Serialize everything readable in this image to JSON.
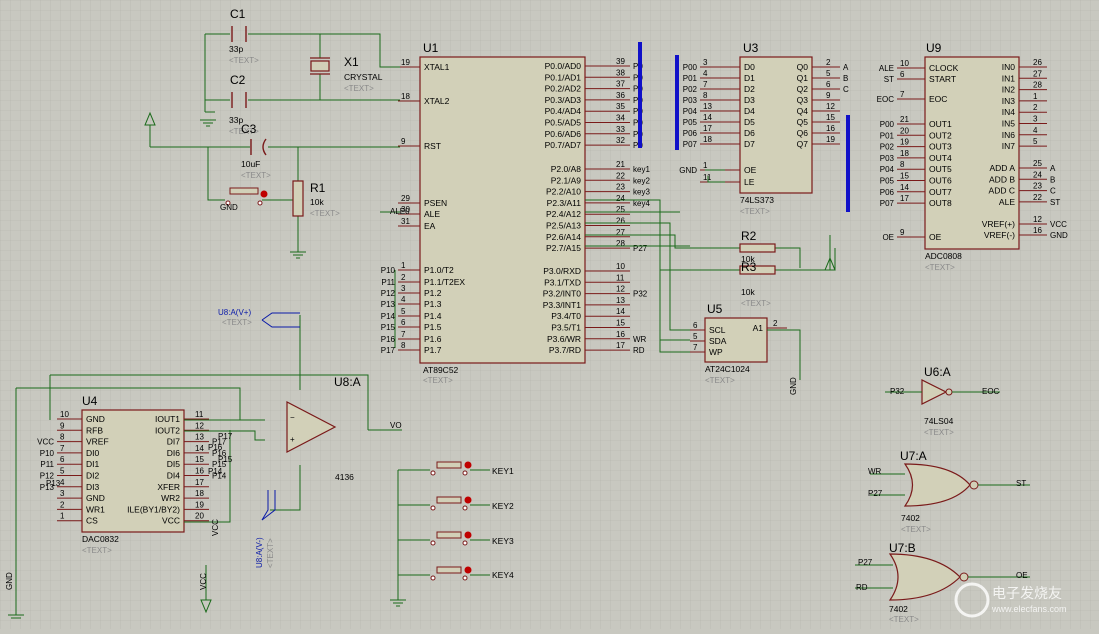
{
  "common": {
    "text_tag": "<TEXT>"
  },
  "u1": {
    "ref": "U1",
    "part": "AT89C52",
    "left": [
      {
        "num": "19",
        "name": "XTAL1"
      },
      {
        "num": "18",
        "name": "XTAL2"
      },
      {
        "num": "9",
        "name": "RST"
      },
      {
        "num": "29",
        "name": "PSEN"
      },
      {
        "num": "30",
        "name": "ALE"
      },
      {
        "num": "31",
        "name": "EA"
      },
      {
        "num": "1",
        "name": "P1.0/T2",
        "net": "P10"
      },
      {
        "num": "2",
        "name": "P1.1/T2EX",
        "net": "P11"
      },
      {
        "num": "3",
        "name": "P1.2",
        "net": "P12"
      },
      {
        "num": "4",
        "name": "P1.3",
        "net": "P13"
      },
      {
        "num": "5",
        "name": "P1.4",
        "net": "P14"
      },
      {
        "num": "6",
        "name": "P1.5",
        "net": "P15"
      },
      {
        "num": "7",
        "name": "P1.6",
        "net": "P16"
      },
      {
        "num": "8",
        "name": "P1.7",
        "net": "P17"
      }
    ],
    "right": [
      {
        "num": "39",
        "name": "P0.0/AD0",
        "net": "P0"
      },
      {
        "num": "38",
        "name": "P0.1/AD1",
        "net": "P0"
      },
      {
        "num": "37",
        "name": "P0.2/AD2",
        "net": "P0"
      },
      {
        "num": "36",
        "name": "P0.3/AD3",
        "net": "P0"
      },
      {
        "num": "35",
        "name": "P0.4/AD4",
        "net": "P0"
      },
      {
        "num": "34",
        "name": "P0.5/AD5",
        "net": "P0"
      },
      {
        "num": "33",
        "name": "P0.6/AD6",
        "net": "P0"
      },
      {
        "num": "32",
        "name": "P0.7/AD7",
        "net": "P0"
      },
      {
        "num": "21",
        "name": "P2.0/A8",
        "net": "key1"
      },
      {
        "num": "22",
        "name": "P2.1/A9",
        "net": "key2"
      },
      {
        "num": "23",
        "name": "P2.2/A10",
        "net": "key3"
      },
      {
        "num": "24",
        "name": "P2.3/A11",
        "net": "key4"
      },
      {
        "num": "25",
        "name": "P2.4/A12"
      },
      {
        "num": "26",
        "name": "P2.5/A13"
      },
      {
        "num": "27",
        "name": "P2.6/A14"
      },
      {
        "num": "28",
        "name": "P2.7/A15",
        "net": "P27"
      },
      {
        "num": "10",
        "name": "P3.0/RXD"
      },
      {
        "num": "11",
        "name": "P3.1/TXD"
      },
      {
        "num": "12",
        "name": "P3.2/INT0",
        "net": "P32"
      },
      {
        "num": "13",
        "name": "P3.3/INT1"
      },
      {
        "num": "14",
        "name": "P3.4/T0"
      },
      {
        "num": "15",
        "name": "P3.5/T1"
      },
      {
        "num": "16",
        "name": "P3.6/WR",
        "net": "WR"
      },
      {
        "num": "17",
        "name": "P3.7/RD",
        "net": "RD"
      }
    ]
  },
  "u3": {
    "ref": "U3",
    "part": "74LS373",
    "left": [
      {
        "num": "3",
        "name": "D0",
        "net": "P00"
      },
      {
        "num": "4",
        "name": "D1",
        "net": "P01"
      },
      {
        "num": "7",
        "name": "D2",
        "net": "P02"
      },
      {
        "num": "8",
        "name": "D3",
        "net": "P03"
      },
      {
        "num": "13",
        "name": "D4",
        "net": "P04"
      },
      {
        "num": "14",
        "name": "D5",
        "net": "P05"
      },
      {
        "num": "17",
        "name": "D6",
        "net": "P06"
      },
      {
        "num": "18",
        "name": "D7",
        "net": "P07"
      },
      {
        "num": "1",
        "name": "OE",
        "net": "GND"
      },
      {
        "num": "11",
        "name": "LE"
      }
    ],
    "right": [
      {
        "num": "2",
        "name": "Q0",
        "net": "A"
      },
      {
        "num": "5",
        "name": "Q1",
        "net": "B"
      },
      {
        "num": "6",
        "name": "Q2",
        "net": "C"
      },
      {
        "num": "9",
        "name": "Q3"
      },
      {
        "num": "12",
        "name": "Q4"
      },
      {
        "num": "15",
        "name": "Q5"
      },
      {
        "num": "16",
        "name": "Q6"
      },
      {
        "num": "19",
        "name": "Q7"
      }
    ]
  },
  "u9": {
    "ref": "U9",
    "part": "ADC0808",
    "left": [
      {
        "num": "10",
        "name": "CLOCK",
        "net": "ALE"
      },
      {
        "num": "6",
        "name": "START",
        "net": "ST"
      },
      {
        "num": "7",
        "name": "EOC",
        "net": "EOC"
      },
      {
        "num": "21",
        "name": "OUT1",
        "net": "P00"
      },
      {
        "num": "20",
        "name": "OUT2",
        "net": "P01"
      },
      {
        "num": "19",
        "name": "OUT3",
        "net": "P02"
      },
      {
        "num": "18",
        "name": "OUT4",
        "net": "P03"
      },
      {
        "num": "8",
        "name": "OUT5",
        "net": "P04"
      },
      {
        "num": "15",
        "name": "OUT6",
        "net": "P05"
      },
      {
        "num": "14",
        "name": "OUT7",
        "net": "P06"
      },
      {
        "num": "17",
        "name": "OUT8",
        "net": "P07"
      },
      {
        "num": "9",
        "name": "OE",
        "net": "OE"
      }
    ],
    "right": [
      {
        "num": "26",
        "name": "IN0"
      },
      {
        "num": "27",
        "name": "IN1"
      },
      {
        "num": "28",
        "name": "IN2"
      },
      {
        "num": "1",
        "name": "IN3"
      },
      {
        "num": "2",
        "name": "IN4"
      },
      {
        "num": "3",
        "name": "IN5"
      },
      {
        "num": "4",
        "name": "IN6"
      },
      {
        "num": "5",
        "name": "IN7"
      },
      {
        "num": "25",
        "name": "ADD A",
        "net": "A"
      },
      {
        "num": "24",
        "name": "ADD B",
        "net": "B"
      },
      {
        "num": "23",
        "name": "ADD C",
        "net": "C"
      },
      {
        "num": "22",
        "name": "ALE",
        "net": "ST"
      },
      {
        "num": "12",
        "name": "VREF(+)",
        "net": "VCC"
      },
      {
        "num": "16",
        "name": "VREF(-)",
        "net": "GND"
      }
    ]
  },
  "u4": {
    "ref": "U4",
    "part": "DAC0832",
    "left": [
      {
        "num": "10",
        "name": "GND"
      },
      {
        "num": "9",
        "name": "RFB"
      },
      {
        "num": "8",
        "name": "VREF",
        "net": "VCC"
      },
      {
        "num": "7",
        "name": "DI0",
        "net": "P10"
      },
      {
        "num": "6",
        "name": "DI1",
        "net": "P11"
      },
      {
        "num": "5",
        "name": "DI2",
        "net": "P12"
      },
      {
        "num": "4",
        "name": "DI3",
        "net": "P13"
      },
      {
        "num": "3",
        "name": "GND"
      },
      {
        "num": "2",
        "name": "WR1"
      },
      {
        "num": "1",
        "name": "CS"
      }
    ],
    "right": [
      {
        "num": "11",
        "name": "IOUT1"
      },
      {
        "num": "12",
        "name": "IOUT2"
      },
      {
        "num": "13",
        "name": "DI7",
        "net": "P17"
      },
      {
        "num": "14",
        "name": "DI6",
        "net": "P16"
      },
      {
        "num": "15",
        "name": "DI5",
        "net": "P15"
      },
      {
        "num": "16",
        "name": "DI4",
        "net": "P14"
      },
      {
        "num": "17",
        "name": "XFER"
      },
      {
        "num": "18",
        "name": "WR2"
      },
      {
        "num": "19",
        "name": "ILE(BY1/BY2)"
      },
      {
        "num": "20",
        "name": "VCC"
      }
    ]
  },
  "u5": {
    "ref": "U5",
    "part": "AT24C1024",
    "left": [
      {
        "num": "6",
        "name": "SCL"
      },
      {
        "num": "5",
        "name": "SDA"
      },
      {
        "num": "7",
        "name": "WP"
      }
    ],
    "right": [
      {
        "num": "2",
        "name": "A1"
      }
    ]
  },
  "u8a": {
    "ref": "U8:A",
    "part": "",
    "minus": "−",
    "plus": "+",
    "vplus_label": "U8:A(V+)",
    "vminus_label": "U8:A(V-)"
  },
  "u6a": {
    "ref": "U6:A",
    "part": "74LS04"
  },
  "u7a": {
    "ref": "U7:A",
    "part": "7402"
  },
  "u7b": {
    "ref": "U7:B",
    "part": "7402"
  },
  "c1": {
    "ref": "C1",
    "value": "33p"
  },
  "c2": {
    "ref": "C2",
    "value": "33p"
  },
  "c3": {
    "ref": "C3",
    "value": "10uF"
  },
  "x1": {
    "ref": "X1",
    "value": "CRYSTAL"
  },
  "r1": {
    "ref": "R1",
    "value": "10k"
  },
  "r2": {
    "ref": "R2",
    "value": "10k"
  },
  "r3": {
    "ref": "R3",
    "value": "10k"
  },
  "keys": [
    "KEY1",
    "KEY2",
    "KEY3",
    "KEY4"
  ],
  "misc": {
    "opamp_part": "4136"
  },
  "net_labels": [
    {
      "text": "ALE0"
    },
    {
      "text": "VO"
    },
    {
      "text": "GND"
    },
    {
      "text": "VCC"
    },
    {
      "text": "GND"
    },
    {
      "text": "EOC"
    },
    {
      "text": "P32"
    },
    {
      "text": "ST"
    },
    {
      "text": "WR"
    },
    {
      "text": "P27"
    },
    {
      "text": "OE"
    },
    {
      "text": "P27"
    },
    {
      "text": "RD"
    },
    {
      "text": "GND"
    },
    {
      "text": "VCC"
    },
    {
      "text": "P13"
    },
    {
      "text": "P17"
    },
    {
      "text": "P16"
    },
    {
      "text": "P15"
    },
    {
      "text": "P14"
    }
  ],
  "watermark": {
    "title": "电子发烧友",
    "url": "www.elecfans.com"
  }
}
